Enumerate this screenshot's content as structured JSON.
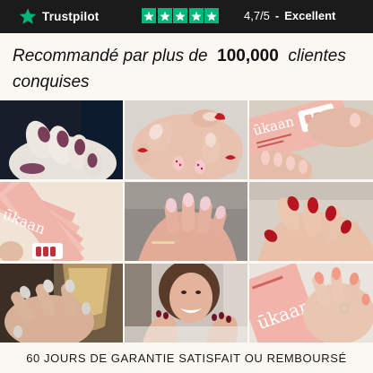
{
  "trustpilot": {
    "brand": "Trustpilot",
    "stars_filled": 5,
    "score": "4,7/5",
    "separator": "-",
    "label": "Excellent",
    "star_color": "#00b67a"
  },
  "headline": {
    "prefix": "Recommandé par plus de",
    "number": "100,000",
    "suffix": "clientes conquises"
  },
  "gallery": {
    "photos": [
      {
        "name": "photo-mauve-nails"
      },
      {
        "name": "photo-red-french-strawberry-nails"
      },
      {
        "name": "photo-pink-nails-box"
      },
      {
        "name": "photo-product-boxes-fan"
      },
      {
        "name": "photo-pale-pink-nails"
      },
      {
        "name": "photo-red-nails"
      },
      {
        "name": "photo-glitter-nails-glass"
      },
      {
        "name": "photo-smiling-woman-burgundy-nails"
      },
      {
        "name": "photo-coral-nails-box"
      }
    ],
    "box_brand": "ūkaan"
  },
  "footer": {
    "guarantee": "60 JOURS DE GARANTIE SATISFAIT OU REMBOURSÉ"
  }
}
